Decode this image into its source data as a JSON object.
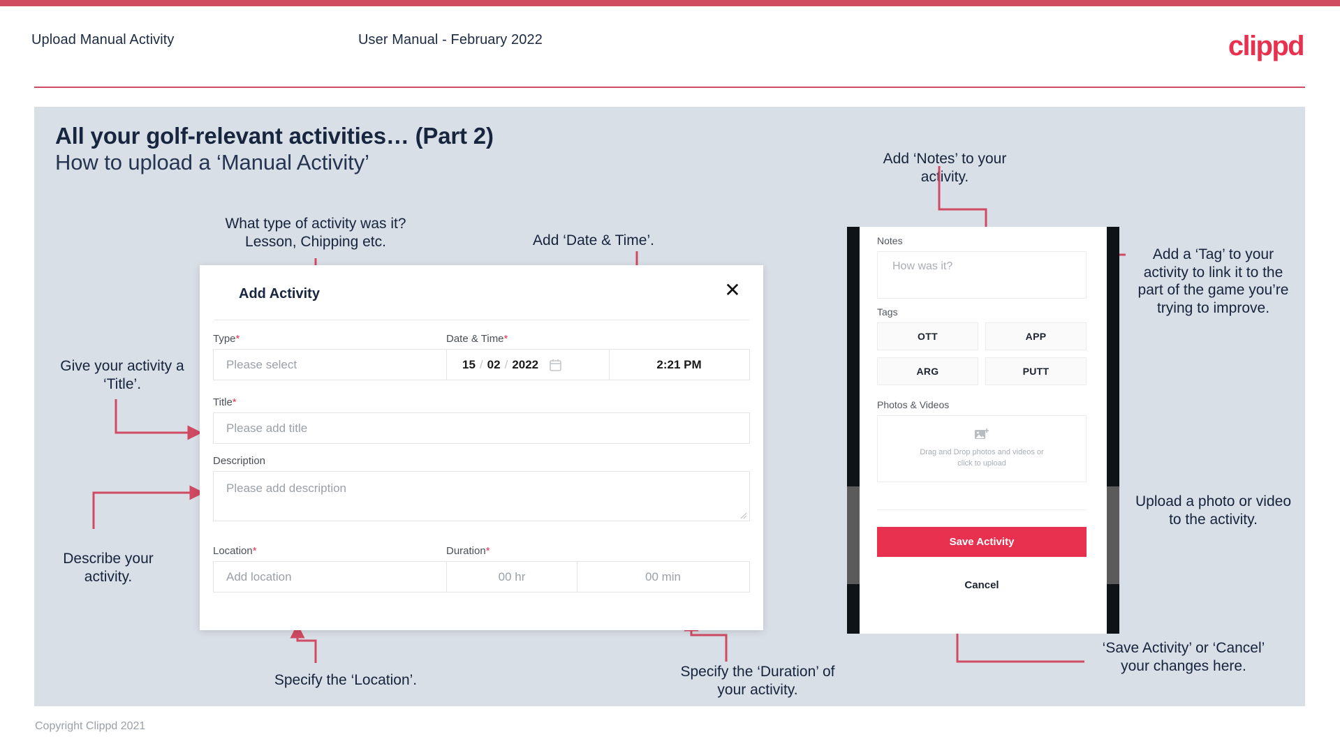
{
  "header": {
    "left_title": "Upload Manual Activity",
    "center_title": "User Manual - February 2022",
    "logo": "clippd",
    "accent_color": "#e8314f",
    "rule_color": "#cf4a63"
  },
  "slide": {
    "title": "All your golf-relevant activities… (Part 2)",
    "subtitle": "How to upload a ‘Manual Activity’",
    "background": "#d9dfe6"
  },
  "annotations": {
    "type": "What type of activity was it?\nLesson, Chipping etc.",
    "type_line1": "What type of activity was it?",
    "type_line2": "Lesson, Chipping etc.",
    "datetime": "Add ‘Date & Time’.",
    "notes": "Add ‘Notes’ to your\nactivity.",
    "notes_line1": "Add ‘Notes’ to your",
    "notes_line2": "activity.",
    "title_field": "Give your activity a\n‘Title’.",
    "title_line1": "Give your activity a",
    "title_line2": "‘Title’.",
    "description": "Describe your\nactivity.",
    "description_line1": "Describe your",
    "description_line2": "activity.",
    "tag": "Add a ‘Tag’ to your activity to link it to the part of the game you’re trying to improve.",
    "upload": "Upload a photo or video to the activity.",
    "location": "Specify the ‘Location’.",
    "duration": "Specify the ‘Duration’ of your activity.",
    "save_cancel": "‘Save Activity’ or ‘Cancel’ your changes here."
  },
  "dialog": {
    "title": "Add Activity",
    "close_icon": "close-icon",
    "fields": {
      "type": {
        "label": "Type",
        "required": "*",
        "placeholder": "Please select",
        "icon": "chevron-down-icon"
      },
      "datetime": {
        "label": "Date & Time",
        "required": "*",
        "day": "15",
        "month": "02",
        "year": "2022",
        "sep": "/",
        "calendar_icon": "calendar-icon",
        "time": "2:21 PM"
      },
      "title": {
        "label": "Title",
        "required": "*",
        "placeholder": "Please add title"
      },
      "description": {
        "label": "Description",
        "required": "",
        "placeholder": "Please add description"
      },
      "location": {
        "label": "Location",
        "required": "*",
        "placeholder": "Add location"
      },
      "duration": {
        "label": "Duration",
        "required": "*",
        "hours_placeholder": "00 hr",
        "minutes_placeholder": "00 min"
      }
    }
  },
  "phone": {
    "notes": {
      "label": "Notes",
      "placeholder": "How was it?"
    },
    "tags": {
      "label": "Tags",
      "items": [
        "OTT",
        "APP",
        "ARG",
        "PUTT"
      ]
    },
    "photos": {
      "label": "Photos & Videos",
      "icon": "add-image-icon",
      "dropzone_line1": "Drag and Drop photos and videos or",
      "dropzone_line2": "click to upload"
    },
    "save_label": "Save Activity",
    "cancel_label": "Cancel",
    "save_color": "#e8314f"
  },
  "footer": {
    "copyright": "Copyright Clippd 2021"
  }
}
